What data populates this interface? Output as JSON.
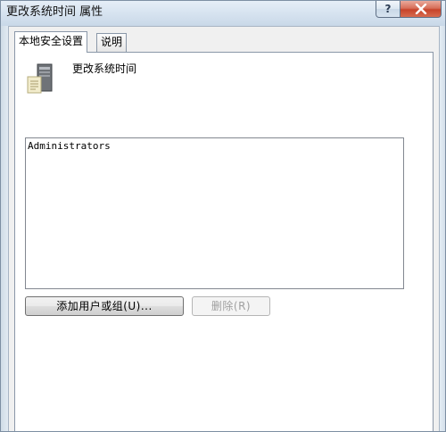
{
  "window": {
    "title": "更改系统时间 属性",
    "help_label": "?"
  },
  "tabs": [
    {
      "label": "本地安全设置",
      "active": true
    },
    {
      "label": "说明",
      "active": false
    }
  ],
  "policy": {
    "name": "更改系统时间",
    "icon": "policy-computer-icon"
  },
  "accounts": {
    "items": [
      "Administrators"
    ]
  },
  "buttons": {
    "add_label": "添加用户或组(U)...",
    "remove_label": "删除(R)",
    "remove_enabled": false
  },
  "colors": {
    "close_button": "#c7432a",
    "panel_background": "#ffffff",
    "frame": "#dce7f2"
  }
}
